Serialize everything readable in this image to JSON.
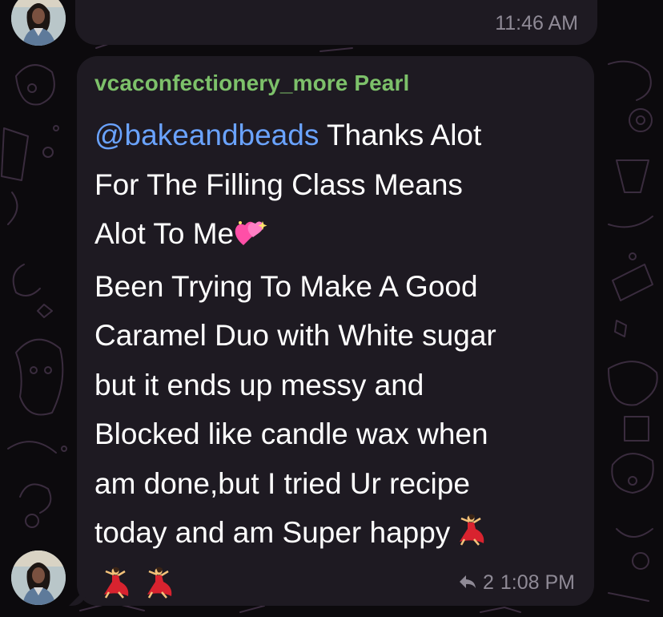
{
  "previous_message": {
    "time": "11:46 AM"
  },
  "message": {
    "sender": "vcaconfectionery_more Pearl",
    "mention": "@bakeandbeads",
    "text_line1_after_mention": " Thanks Alot",
    "text_line2": "For The Filling Class Means",
    "text_line3": "Alot To Me",
    "text_line4": "Been Trying To Make A Good",
    "text_line5": "Caramel Duo with White sugar",
    "text_line6": "but it ends up messy and",
    "text_line7": "Blocked like candle wax when",
    "text_line8": "am done,but I tried Ur recipe",
    "text_line9": "today and am Super happy",
    "reply_count": "2",
    "time": "1:08 PM"
  },
  "icons": {
    "heart_emoji": "sparkling-hearts-icon",
    "dancer_emoji": "dancing-woman-icon",
    "reply_arrow": "reply-arrow-icon"
  },
  "colors": {
    "background": "#0c0a0d",
    "bubble": "#1e1a22",
    "sender": "#7dc16a",
    "mention": "#6aa3ff",
    "meta": "#8f8a96"
  }
}
